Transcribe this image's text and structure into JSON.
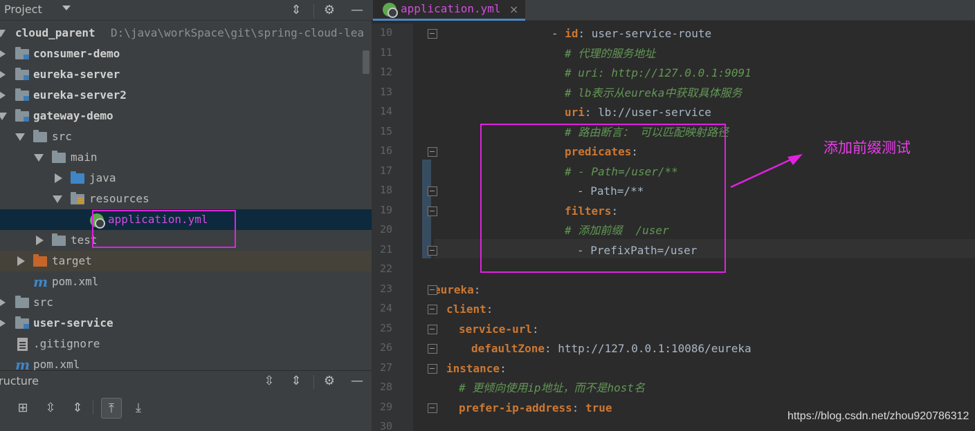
{
  "project_panel": {
    "title": "Project",
    "tree": [
      {
        "label": "cloud_parent",
        "path": "D:\\java\\workSpace\\git\\spring-cloud-lea"
      },
      {
        "label": "consumer-demo"
      },
      {
        "label": "eureka-server"
      },
      {
        "label": "eureka-server2"
      },
      {
        "label": "gateway-demo"
      },
      {
        "label": "src"
      },
      {
        "label": "main"
      },
      {
        "label": "java"
      },
      {
        "label": "resources"
      },
      {
        "label": "application.yml"
      },
      {
        "label": "test"
      },
      {
        "label": "target"
      },
      {
        "label": "pom.xml"
      },
      {
        "label": "src"
      },
      {
        "label": "user-service"
      },
      {
        "label": ".gitignore"
      },
      {
        "label": "pom.xml"
      }
    ]
  },
  "structure_panel": {
    "title": "ructure"
  },
  "editor": {
    "tab_label": "application.yml",
    "tab_close": "×",
    "line_numbers": [
      "10",
      "11",
      "12",
      "13",
      "14",
      "15",
      "16",
      "17",
      "18",
      "19",
      "20",
      "21",
      "22",
      "23",
      "24",
      "25",
      "26",
      "27",
      "28",
      "29",
      "30"
    ],
    "lines": [
      {
        "dash": "- ",
        "key": "id",
        "sep": ": ",
        "value": "user-service-route"
      },
      {
        "comment": "# 代理的服务地址"
      },
      {
        "comment": "# uri: http://127.0.0.1:9091"
      },
      {
        "comment": "# lb表示从eureka中获取具体服务"
      },
      {
        "key": "uri",
        "sep": ": ",
        "value": "lb://user-service"
      },
      {
        "comment": "# 路由断言： 可以匹配映射路径"
      },
      {
        "key": "predicates",
        "sep": ":"
      },
      {
        "comment": "# - Path=/user/**"
      },
      {
        "value": "- Path=/**"
      },
      {
        "key": "filters",
        "sep": ":"
      },
      {
        "comment": "# 添加前缀  /user"
      },
      {
        "value": "- PrefixPath=/user"
      },
      {},
      {
        "key": "eureka",
        "sep": ":"
      },
      {
        "key": "client",
        "sep": ":"
      },
      {
        "key": "service-url",
        "sep": ":"
      },
      {
        "key": "defaultZone",
        "sep": ": ",
        "value": "http://127.0.0.1:10086/eureka"
      },
      {
        "key": "instance",
        "sep": ":"
      },
      {
        "comment": "# 更倾向使用ip地址，而不是host名"
      },
      {
        "key": "prefer-ip-address",
        "sep": ": ",
        "value_kw": "true"
      },
      {}
    ]
  },
  "annotation": {
    "text": "添加前缀测试"
  },
  "watermark": "https://blog.csdn.net/zhou920786312",
  "colors": {
    "highlight": "#e022e0",
    "key": "#cc7832",
    "comment": "#629755"
  }
}
